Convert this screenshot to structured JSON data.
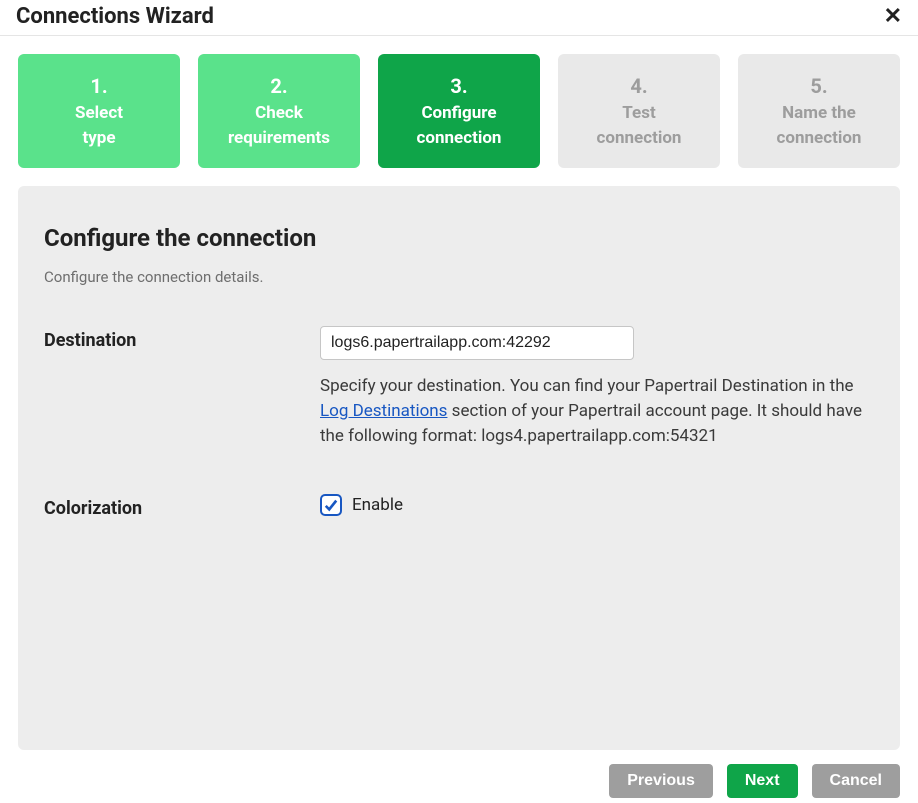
{
  "header": {
    "title": "Connections Wizard"
  },
  "steps": [
    {
      "num": "1.",
      "label_line1": "Select",
      "label_line2": "type",
      "state": "completed"
    },
    {
      "num": "2.",
      "label_line1": "Check",
      "label_line2": "requirements",
      "state": "completed"
    },
    {
      "num": "3.",
      "label_line1": "Configure",
      "label_line2": "connection",
      "state": "current"
    },
    {
      "num": "4.",
      "label_line1": "Test",
      "label_line2": "connection",
      "state": "upcoming"
    },
    {
      "num": "5.",
      "label_line1": "Name the",
      "label_line2": "connection",
      "state": "upcoming"
    }
  ],
  "panel": {
    "heading": "Configure the connection",
    "description": "Configure the connection details.",
    "destination": {
      "label": "Destination",
      "value": "logs6.papertrailapp.com:42292",
      "help_pre": "Specify your destination. You can find your Papertrail Destination in the ",
      "help_link": "Log Destinations",
      "help_post": " section of your Papertrail account page. It should have the following format: logs4.papertrailapp.com:54321"
    },
    "colorization": {
      "label": "Colorization",
      "checkbox_label": "Enable",
      "checked": true
    }
  },
  "footer": {
    "previous": "Previous",
    "next": "Next",
    "cancel": "Cancel"
  }
}
